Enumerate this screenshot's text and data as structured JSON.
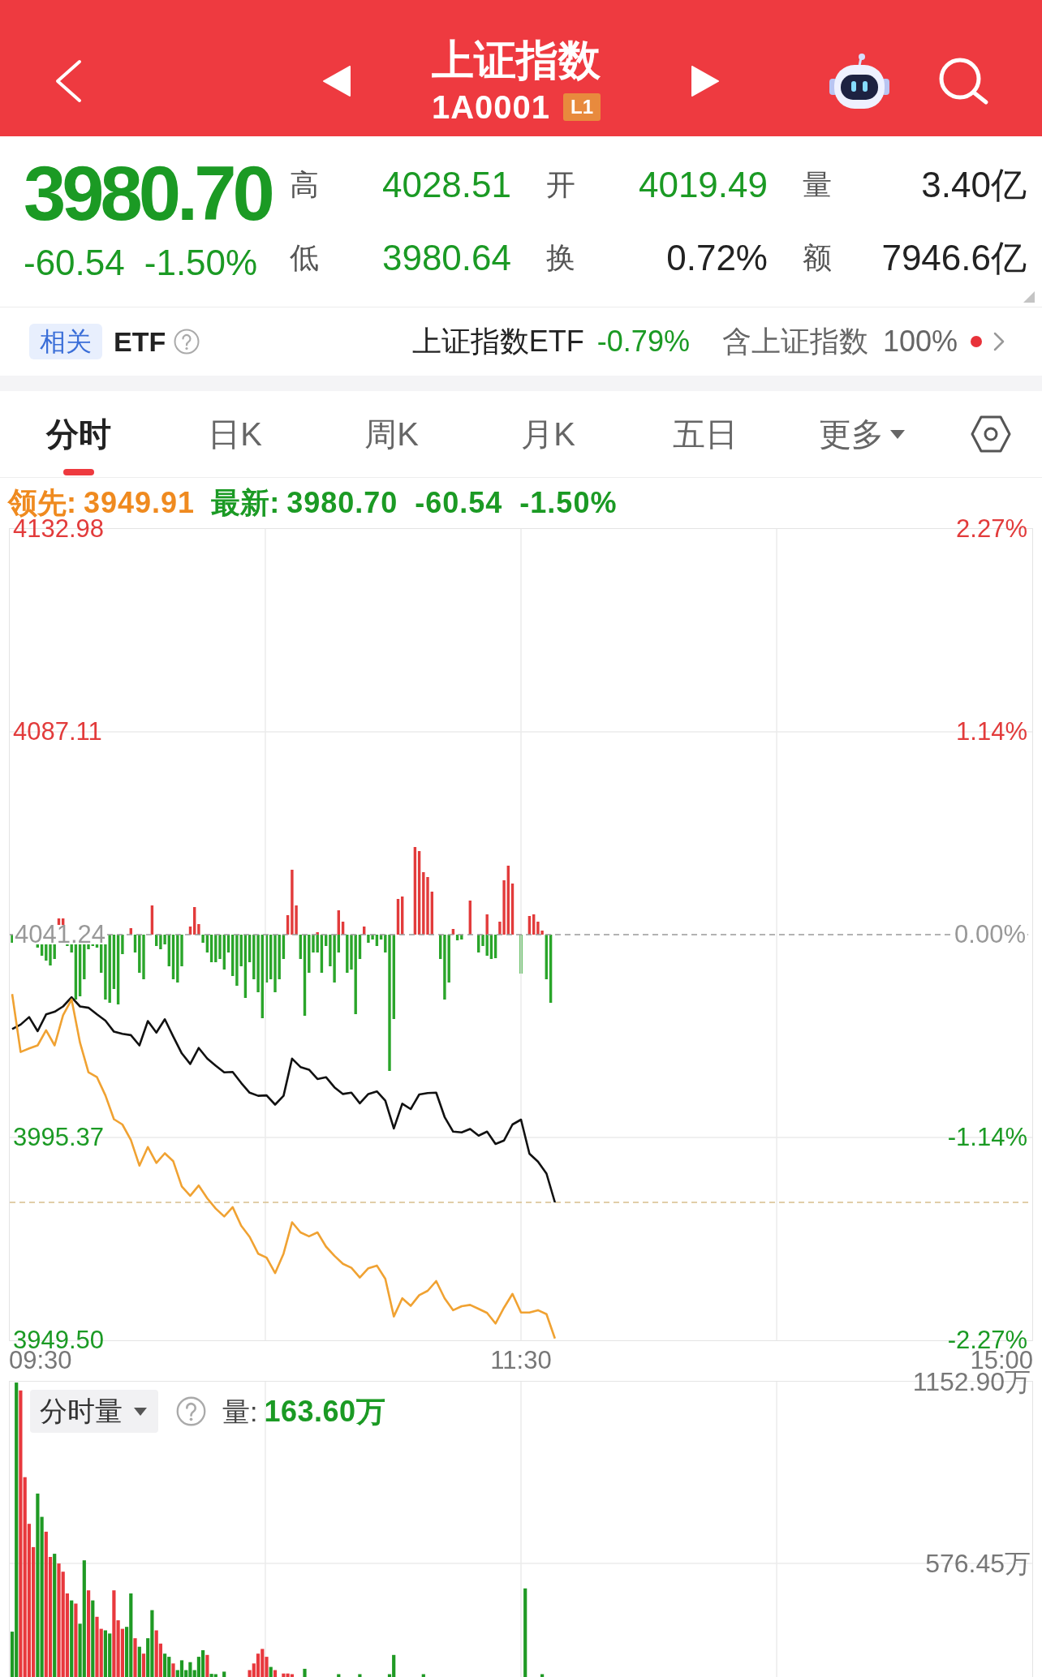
{
  "header": {
    "title": "上证指数",
    "code": "1A0001",
    "level_badge": "L1"
  },
  "quote": {
    "down": true,
    "price": "3980.70",
    "change": "-60.54",
    "change_percent": "-1.50%",
    "stats": [
      {
        "label": "高",
        "value": "4028.51",
        "color": "#1b9a24"
      },
      {
        "label": "开",
        "value": "4019.49",
        "color": "#1b9a24"
      },
      {
        "label": "量",
        "value": "3.40亿",
        "color": "#222222"
      },
      {
        "label": "低",
        "value": "3980.64",
        "color": "#1b9a24"
      },
      {
        "label": "换",
        "value": "0.72%",
        "color": "#222222"
      },
      {
        "label": "额",
        "value": "7946.6亿",
        "color": "#222222"
      }
    ]
  },
  "related_etf": {
    "tag": "相关",
    "heading": "ETF",
    "fund_name": "上证指数ETF",
    "fund_change": "-0.79%",
    "fund_down": true,
    "holding_label": "含上证指数",
    "holding_share": "100%"
  },
  "tabs": [
    {
      "label": "分时",
      "selected": true,
      "kind": "plain"
    },
    {
      "label": "日K",
      "selected": false,
      "kind": "plain"
    },
    {
      "label": "周K",
      "selected": false,
      "kind": "plain"
    },
    {
      "label": "月K",
      "selected": false,
      "kind": "plain"
    },
    {
      "label": "五日",
      "selected": false,
      "kind": "plain"
    },
    {
      "label": "更多",
      "selected": false,
      "kind": "dropdown"
    }
  ],
  "intraday": {
    "leader": {
      "label": "领先:",
      "value": "3949.91"
    },
    "latest": {
      "label": "最新:",
      "value": "3980.70",
      "change": "-60.54",
      "change_percent": "-1.50%"
    },
    "percent_labels": [
      "2.27%",
      "1.14%",
      "0.00%",
      "-1.14%",
      "-2.27%"
    ],
    "chart_data": {
      "type": "line",
      "grid": true,
      "categories": [
        null,
        null,
        null,
        null,
        null,
        null,
        null,
        null,
        null,
        null,
        null,
        null,
        null,
        null,
        null,
        null,
        null,
        null,
        null,
        null,
        null,
        null,
        null,
        null,
        null,
        null,
        null,
        null,
        null,
        null,
        null,
        null,
        null,
        null,
        null,
        null,
        null,
        null,
        null,
        null,
        null,
        null,
        null,
        null,
        null,
        null,
        null,
        null,
        null,
        null,
        null,
        null,
        null,
        null,
        null,
        null,
        null,
        null,
        null,
        null,
        null,
        null,
        null,
        null,
        null,
        null,
        null,
        null,
        null,
        null,
        null,
        null,
        null,
        null,
        null,
        null,
        null,
        null,
        null,
        null,
        null,
        null,
        null,
        null,
        null,
        null,
        null,
        null,
        null,
        null,
        null,
        null,
        null,
        null,
        null,
        null,
        null,
        null,
        null,
        null,
        null,
        null,
        null,
        null,
        null,
        null,
        null,
        null,
        null,
        null,
        null,
        null,
        null,
        null,
        null,
        null,
        null,
        null,
        null,
        null,
        null
      ],
      "series": [
        {
          "color": "#111111",
          "values": [
            4019.9,
            4020.9,
            4022.6,
            4019.4,
            4023.2,
            4023.8,
            4025.0,
            4027.1,
            4025.0,
            4024.7,
            4023.2,
            4021.8,
            4019.3,
            4018.8,
            4018.5,
            4016.2,
            4021.7,
            4019.1,
            4022.1,
            4018.2,
            4014.4,
            4012.0,
            4015.6,
            4013.2,
            4011.6,
            4010.1,
            4010.2,
            4007.7,
            4005.5,
            4004.8,
            4004.9,
            4002.8,
            4004.8,
            4013.2,
            4011.3,
            4010.7,
            4008.6,
            4009.0,
            4006.7,
            4005.2,
            4005.5,
            4003.1,
            4005.2,
            4005.8,
            4003.7,
            3997.4,
            4003.0,
            4001.8,
            4005.1,
            4005.4,
            4005.5,
            4000.0,
            3996.7,
            3996.5,
            3997.3,
            3995.8,
            3996.7,
            3993.9,
            3994.7,
            3998.3,
            3999.4,
            3991.7,
            3989.9,
            3987.2,
            3980.7,
            null,
            null,
            null,
            null,
            null,
            null,
            null,
            null,
            null,
            null,
            null,
            null,
            null,
            null,
            null,
            null,
            null,
            null,
            null,
            null,
            null,
            null,
            null,
            null,
            null,
            null,
            null,
            null,
            null,
            null,
            null,
            null,
            null,
            null,
            null,
            null,
            null,
            null,
            null,
            null,
            null,
            null,
            null,
            null,
            null,
            null,
            null,
            null,
            null,
            null,
            null,
            null,
            null,
            null,
            null,
            null
          ]
        },
        {
          "color": "#f0a232",
          "values": [
            4027.8,
            4014.7,
            4015.5,
            4016.2,
            4019.6,
            4016.2,
            4023.0,
            4026.6,
            4016.8,
            4010.1,
            4009.0,
            4004.9,
            3999.5,
            3998.3,
            3994.8,
            3989.0,
            3993.2,
            3989.6,
            3991.8,
            3990.0,
            3984.3,
            3982.2,
            3984.5,
            3981.6,
            3979.3,
            3977.5,
            3979.6,
            3975.4,
            3972.9,
            3969.1,
            3968.2,
            3964.7,
            3969.1,
            3976.2,
            3973.9,
            3973.0,
            3973.9,
            3970.7,
            3968.6,
            3966.8,
            3965.9,
            3963.7,
            3965.8,
            3966.4,
            3963.4,
            3954.9,
            3959.0,
            3957.3,
            3959.7,
            3960.7,
            3962.9,
            3959.0,
            3956.3,
            3957.2,
            3957.5,
            3956.6,
            3955.7,
            3953.3,
            3956.9,
            3960.0,
            3955.8,
            3955.8,
            3956.3,
            3955.4,
            3949.9,
            null,
            null,
            null,
            null,
            null,
            null,
            null,
            null,
            null,
            null,
            null,
            null,
            null,
            null,
            null,
            null,
            null,
            null,
            null,
            null,
            null,
            null,
            null,
            null,
            null,
            null,
            null,
            null,
            null,
            null,
            null,
            null,
            null,
            null,
            null,
            null,
            null,
            null,
            null,
            null,
            null,
            null,
            null,
            null,
            null,
            null,
            null,
            null,
            null,
            null,
            null,
            null,
            null,
            null,
            null,
            null
          ]
        }
      ],
      "ylim": [
        3949.5,
        4132.98
      ],
      "yticks": [
        {
          "value": 4132.98,
          "label": "4132.98"
        },
        {
          "value": 4087.11,
          "label": "4087.11"
        },
        {
          "value": 4041.24,
          "label": "4041.24"
        },
        {
          "value": 3995.37,
          "label": "3995.37"
        },
        {
          "value": 3949.5,
          "label": "3949.50"
        }
      ],
      "ref_lines": [
        {
          "axis": "y",
          "value": 4041.24,
          "color": "#9a9a9a"
        },
        {
          "axis": "y",
          "value": 3980.7,
          "color": "#d7bf8c"
        }
      ]
    },
    "time_labels": [
      "09:30",
      "11:30",
      "15:00"
    ]
  },
  "volume": {
    "selector": "分时量",
    "label": "量:",
    "value": "163.60万",
    "chart_data": {
      "type": "bar",
      "grid": true,
      "categories": [
        null,
        null,
        null,
        null,
        null,
        null,
        null,
        null,
        null,
        null,
        null,
        null,
        null,
        null,
        null,
        null,
        null,
        null,
        null,
        null,
        null,
        null,
        null,
        null,
        null,
        null,
        null,
        null,
        null,
        null,
        null,
        null,
        null,
        null,
        null,
        null,
        null,
        null,
        null,
        null,
        null,
        null,
        null,
        null,
        null,
        null,
        null,
        null,
        null,
        null,
        null,
        null,
        null,
        null,
        null,
        null,
        null,
        null,
        null,
        null,
        null,
        null,
        null,
        null,
        null,
        null,
        null,
        null,
        null,
        null,
        null,
        null,
        null,
        null,
        null,
        null,
        null,
        null,
        null,
        null,
        null,
        null,
        null,
        null,
        null,
        null,
        null,
        null,
        null,
        null,
        null,
        null,
        null,
        null,
        null,
        null,
        null,
        null,
        null,
        null,
        null,
        null,
        null,
        null,
        null,
        null,
        null,
        null,
        null,
        null,
        null,
        null,
        null,
        null,
        null,
        null,
        null,
        null,
        null,
        null,
        null,
        null,
        null,
        null,
        null,
        null,
        null,
        null,
        null,
        null,
        null,
        null,
        null,
        null,
        null,
        null,
        null,
        null,
        null,
        null,
        null,
        null,
        null,
        null,
        null,
        null,
        null,
        null,
        null,
        null,
        null,
        null,
        null,
        null,
        null,
        null,
        null,
        null,
        null,
        null,
        null,
        null,
        null,
        null,
        null,
        null,
        null,
        null,
        null,
        null,
        null,
        null,
        null,
        null,
        null,
        null,
        null,
        null,
        null,
        null,
        null,
        null,
        null,
        null,
        null,
        null,
        null,
        null,
        null,
        null,
        null,
        null,
        null,
        null,
        null,
        null,
        null,
        null,
        null,
        null,
        null,
        null,
        null,
        null,
        null,
        null,
        null,
        null,
        null,
        null,
        null,
        null,
        null,
        null,
        null,
        null,
        null,
        null,
        null,
        null,
        null,
        null,
        null,
        null,
        null,
        null,
        null,
        null,
        null,
        null,
        null,
        null,
        null,
        null,
        null,
        null,
        null,
        null,
        null,
        null,
        null
      ],
      "series": [
        {
          "color": "#e8383d",
          "values": [
            null,
            null,
            1125,
            850,
            702,
            628,
            null,
            null,
            677,
            597,
            null,
            576,
            550,
            481,
            null,
            449,
            null,
            null,
            491,
            null,
            407,
            369,
            null,
            null,
            491,
            396,
            369,
            null,
            null,
            339,
            null,
            290,
            null,
            null,
            364,
            322,
            null,
            null,
            259,
            null,
            null,
            null,
            null,
            null,
            null,
            null,
            286,
            null,
            null,
            null,
            null,
            null,
            null,
            null,
            null,
            null,
            238,
            259,
            290,
            305,
            280,
            null,
            238,
            null,
            227,
            227,
            225,
            null,
            null,
            null,
            null,
            null,
            null,
            null,
            null,
            null,
            null,
            null,
            null,
            null,
            null,
            null,
            null,
            null,
            null,
            null,
            null,
            null,
            null,
            null,
            null,
            null,
            null,
            null,
            null,
            null,
            null,
            null,
            null,
            null,
            null,
            null,
            null,
            null,
            null,
            null,
            null,
            null,
            null,
            null,
            null,
            null,
            null,
            null,
            null,
            null,
            null,
            null,
            null,
            null,
            null,
            null,
            null,
            null,
            null,
            null,
            null,
            null,
            null,
            null,
            null,
            null,
            null,
            null,
            null,
            null,
            null,
            null,
            null,
            null,
            null,
            null,
            null,
            null,
            null,
            null,
            null,
            null,
            null,
            null,
            null,
            null,
            null,
            null,
            null,
            null,
            null,
            null,
            null,
            null,
            null,
            null,
            null,
            null,
            null,
            null,
            null,
            null,
            null,
            null,
            null,
            null,
            null,
            null,
            null,
            null,
            null,
            null,
            null,
            null,
            null,
            null,
            null,
            null,
            null,
            null,
            null,
            null,
            null,
            null,
            null,
            null,
            null,
            null,
            null,
            null,
            null,
            null,
            null,
            null,
            null,
            null,
            null,
            null,
            null,
            null,
            null,
            null,
            null,
            null,
            null,
            null,
            null,
            null,
            null,
            null,
            null,
            null,
            null,
            null,
            null,
            null,
            null,
            null,
            null,
            null,
            null,
            null,
            null,
            null,
            null,
            null,
            null,
            null,
            null,
            null,
            null,
            null,
            null,
            null,
            null
          ]
        },
        {
          "color": "#1f9a24",
          "values": [
            360,
            1150,
            null,
            null,
            null,
            null,
            798,
            724,
            null,
            null,
            607,
            null,
            null,
            null,
            459,
            null,
            385,
            586,
            null,
            459,
            null,
            null,
            364,
            354,
            null,
            null,
            null,
            375,
            481,
            null,
            312,
            null,
            339,
            428,
            null,
            null,
            290,
            280,
            null,
            238,
            269,
            238,
            263,
            238,
            280,
            301,
            null,
            226,
            225,
            null,
            233,
            null,
            null,
            null,
            null,
            null,
            null,
            null,
            null,
            null,
            null,
            248,
            null,
            null,
            null,
            null,
            null,
            null,
            null,
            242,
            null,
            null,
            null,
            null,
            null,
            null,
            null,
            225,
            null,
            null,
            null,
            null,
            225,
            null,
            null,
            null,
            null,
            null,
            null,
            225,
            286,
            null,
            null,
            null,
            null,
            null,
            null,
            225,
            null,
            null,
            null,
            null,
            null,
            null,
            null,
            null,
            null,
            null,
            null,
            null,
            null,
            null,
            null,
            null,
            null,
            null,
            null,
            null,
            null,
            null,
            null,
            497,
            null,
            null,
            null,
            225,
            null,
            null,
            null,
            null,
            null,
            null,
            null,
            null,
            null,
            null,
            null,
            null,
            null,
            null,
            null,
            null,
            null,
            null,
            null,
            null,
            null,
            null,
            null,
            null,
            null,
            null,
            null,
            null,
            null,
            null,
            null,
            null,
            null,
            null,
            null,
            null,
            null,
            null,
            null,
            null,
            null,
            null,
            null,
            null,
            null,
            null,
            null,
            null,
            null,
            null,
            null,
            null,
            null,
            null,
            null,
            null,
            null,
            null,
            null,
            null,
            null,
            null,
            null,
            null,
            null,
            null,
            null,
            null,
            null,
            null,
            null,
            null,
            null,
            null,
            null,
            null,
            null,
            null,
            null,
            null,
            null,
            null,
            null,
            null,
            null,
            null,
            null,
            null,
            null,
            null,
            null,
            null,
            null,
            null,
            null,
            null,
            null,
            null,
            null,
            null,
            null,
            null,
            null,
            null,
            null,
            null,
            null,
            null,
            null,
            null,
            null,
            null,
            null,
            null,
            null
          ]
        }
      ],
      "ylim": [
        216,
        1152.9
      ],
      "yticks": [
        {
          "value": 1152.9,
          "label": "1152.90万"
        },
        {
          "value": 576.45,
          "label": "576.45万"
        }
      ]
    }
  }
}
